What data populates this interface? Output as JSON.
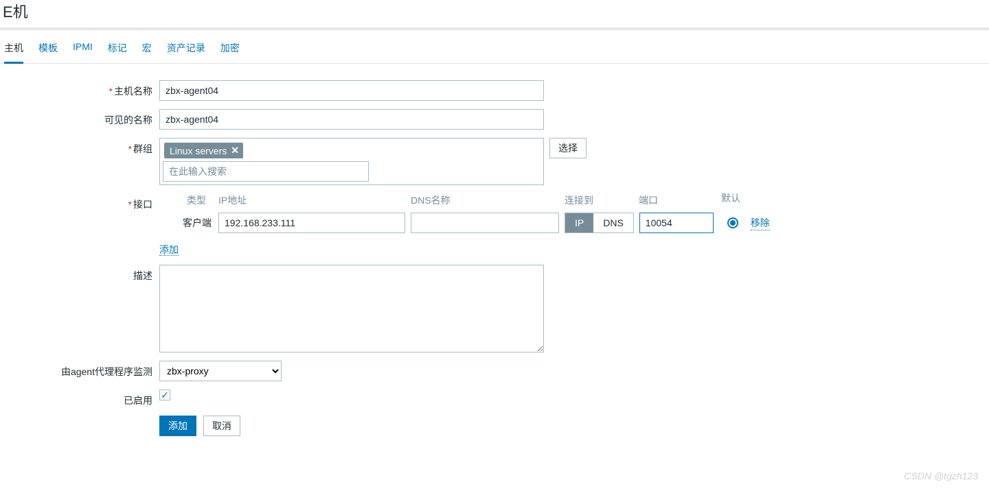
{
  "page_title": "E机",
  "tabs": [
    "主机",
    "模板",
    "IPMI",
    "标记",
    "宏",
    "资产记录",
    "加密"
  ],
  "active_tab": 0,
  "labels": {
    "host_name": "主机名称",
    "visible_name": "可见的名称",
    "groups": "群组",
    "interfaces": "接口",
    "description": "描述",
    "monitored_by_proxy": "由agent代理程序监测",
    "enabled": "已启用"
  },
  "fields": {
    "host_name": "zbx-agent04",
    "visible_name": "zbx-agent04",
    "group_tag": "Linux servers",
    "group_search_placeholder": "在此输入搜索",
    "proxy": "zbx-proxy",
    "enabled_checked": true
  },
  "iface_headers": {
    "type": "类型",
    "ip": "IP地址",
    "dns": "DNS名称",
    "connect": "连接到",
    "port": "端口",
    "default": "默认"
  },
  "interface": {
    "client_label": "客户端",
    "ip": "192.168.233.111",
    "dns": "",
    "connect_options": [
      "IP",
      "DNS"
    ],
    "connect_selected": 0,
    "port": "10054",
    "default_selected": true,
    "remove": "移除"
  },
  "buttons": {
    "select": "选择",
    "add_iface": "添加",
    "submit": "添加",
    "cancel": "取消"
  },
  "watermark": "CSDN @tgzh123"
}
